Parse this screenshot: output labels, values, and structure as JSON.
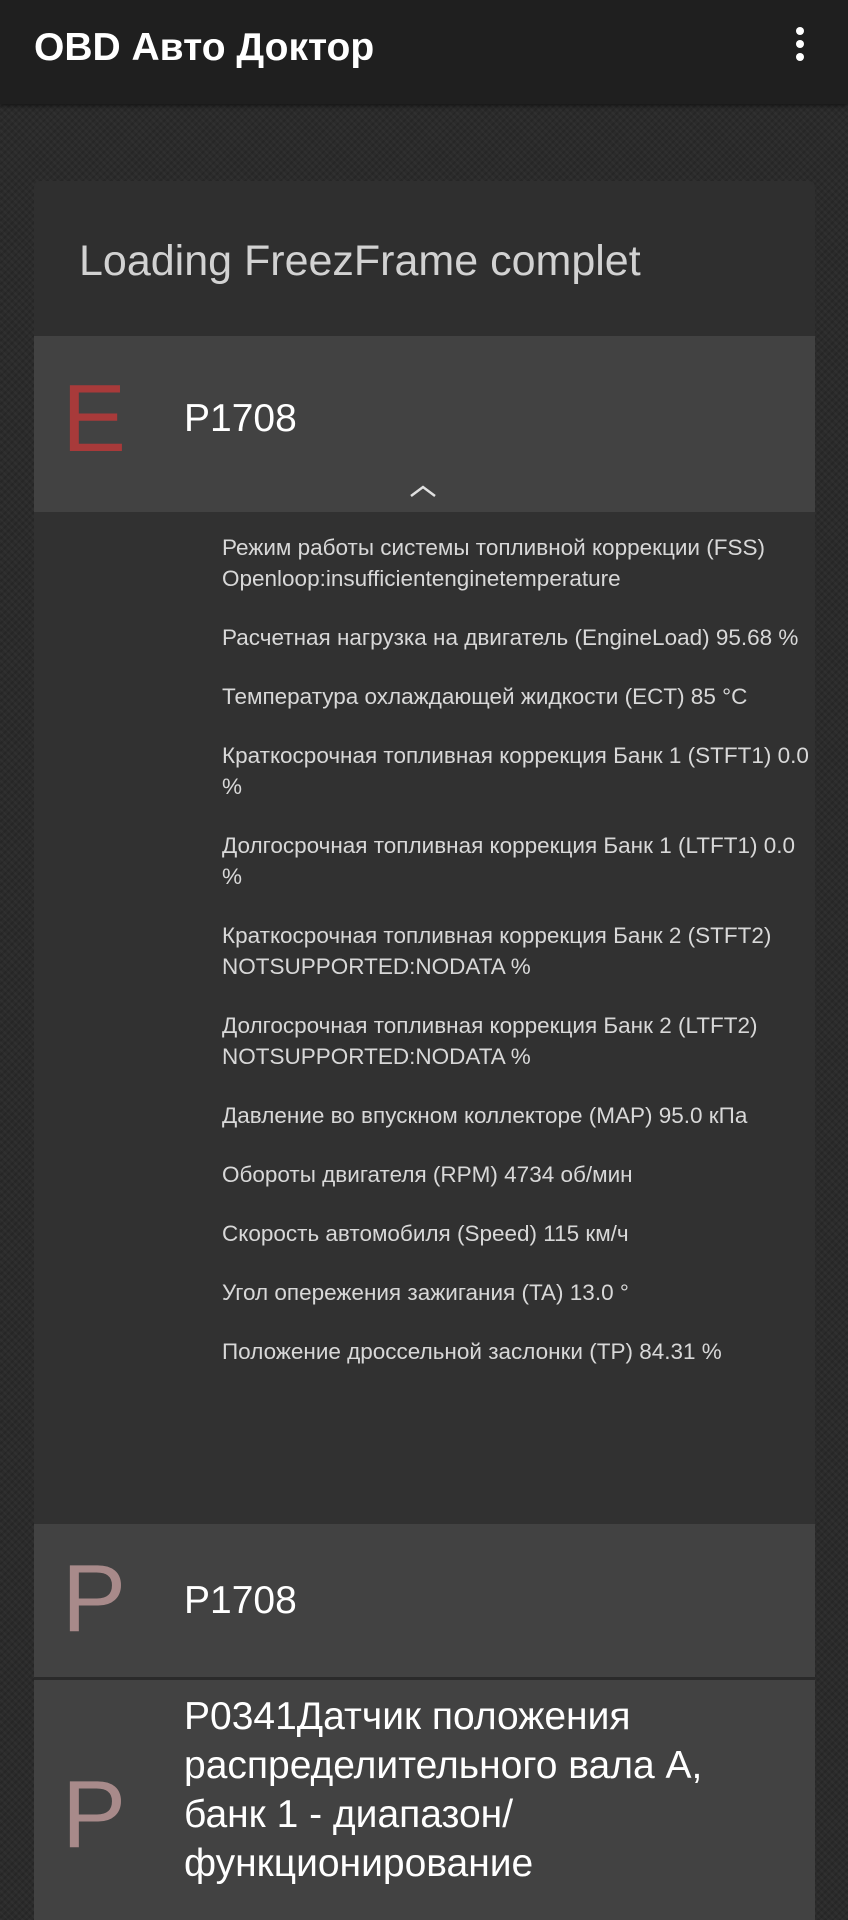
{
  "app_bar": {
    "title": "OBD Авто Доктор",
    "menu_icon": "more-vert-icon"
  },
  "status": "Loading FreezFrame complet",
  "colors": {
    "error_letter": "#a83a3a",
    "pending_letter": "#a88a8a",
    "header_bg": "#424242",
    "app_bar_bg": "#1f1f1f"
  },
  "dtcs": [
    {
      "letter": "E",
      "code": "P1708",
      "expanded": true,
      "details": [
        "Режим работы системы топливной коррекции (FSS) Openloop:insufficientenginetemperature",
        "Расчетная нагрузка на двигатель (EngineLoad) 95.68 %",
        "Температура охлаждающей жидкости (ECT) 85 °C",
        "Краткосрочная топливная коррекция Банк 1 (STFT1) 0.0 %",
        "Долгосрочная топливная коррекция Банк 1 (LTFT1) 0.0 %",
        "Краткосрочная топливная коррекция Банк 2 (STFT2) NOTSUPPORTED:NODATA   %",
        "Долгосрочная топливная коррекция Банк 2 (LTFT2) NOTSUPPORTED:NODATA   %",
        "Давление во впускном коллекторе (MAP) 95.0 кПа",
        "Обороты двигателя (RPM) 4734 об/мин",
        "Скорость автомобиля (Speed) 115 км/ч",
        "Угол опережения зажигания (TA) 13.0 °",
        "Положение дроссельной заслонки (TP) 84.31 %"
      ]
    },
    {
      "letter": "P",
      "code": "P1708",
      "expanded": false
    },
    {
      "letter": "P",
      "code": "P0341Датчик положения распределительного вала А, банк 1 - диапазон/ функционирование",
      "expanded": false
    }
  ]
}
